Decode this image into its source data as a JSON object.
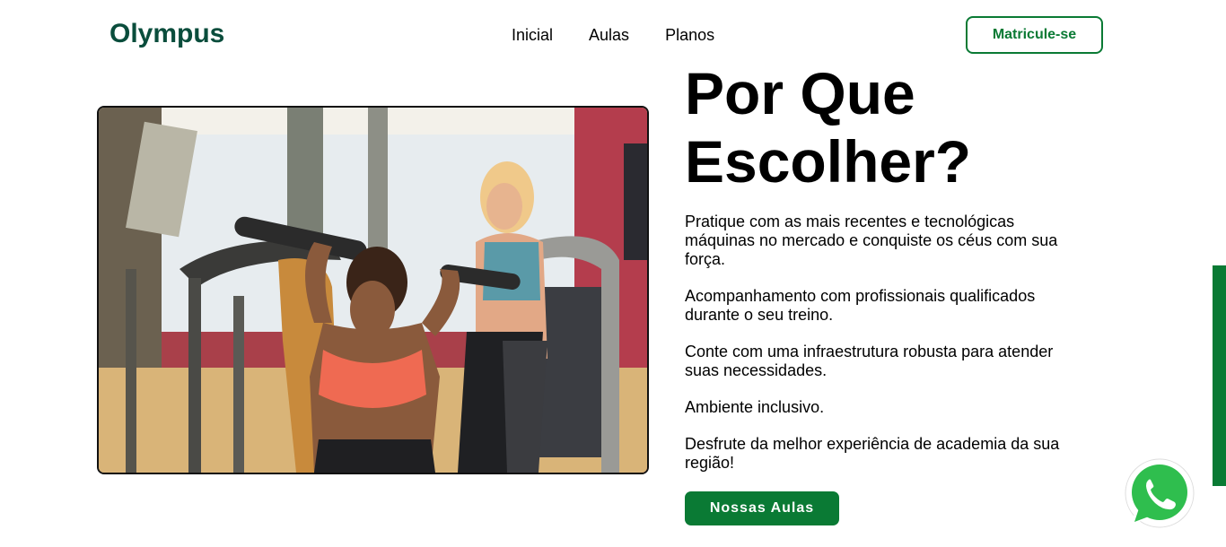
{
  "header": {
    "logo": "Olympus",
    "nav": [
      "Inicial",
      "Aulas",
      "Planos"
    ],
    "cta_label": "Matricule-se"
  },
  "main": {
    "title": "Por Que Escolher?",
    "features": [
      "Pratique com as mais recentes e tecnológicas máquinas no mercado e conquiste os céus com sua força.",
      "Acompanhamento com profissionais qualificados durante o seu treino.",
      "Conte com uma infraestrutura robusta para atender suas necessidades.",
      "Ambiente inclusivo.",
      "Desfrute da melhor experiência de academia da sua região!"
    ],
    "button_label": "Nossas Aulas"
  },
  "icons": {
    "whatsapp": "whatsapp-icon"
  },
  "colors": {
    "brand": "#0a4d3c",
    "accent": "#0a7a34"
  }
}
